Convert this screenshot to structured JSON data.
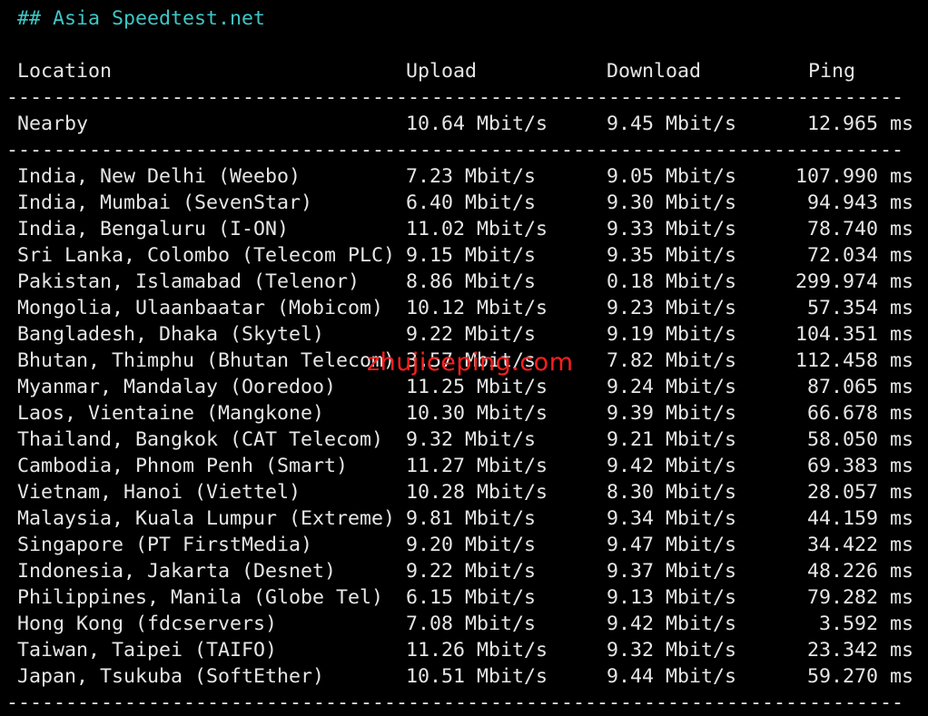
{
  "heading": "## Asia Speedtest.net",
  "columns": {
    "location": "Location",
    "upload": "Upload",
    "download": "Download",
    "ping": "Ping"
  },
  "divider": "----------------------------------------------------------------------------",
  "nearby": {
    "location": "Nearby",
    "upload": "10.64 Mbit/s",
    "download": "9.45 Mbit/s",
    "ping": "12.965 ms"
  },
  "rows": [
    {
      "location": "India, New Delhi (Weebo)",
      "upload": "7.23 Mbit/s",
      "download": "9.05 Mbit/s",
      "ping": "107.990 ms"
    },
    {
      "location": "India, Mumbai (SevenStar)",
      "upload": "6.40 Mbit/s",
      "download": "9.30 Mbit/s",
      "ping": "94.943 ms"
    },
    {
      "location": "India, Bengaluru (I-ON)",
      "upload": "11.02 Mbit/s",
      "download": "9.33 Mbit/s",
      "ping": "78.740 ms"
    },
    {
      "location": "Sri Lanka, Colombo (Telecom PLC)",
      "upload": "9.15 Mbit/s",
      "download": "9.35 Mbit/s",
      "ping": "72.034 ms"
    },
    {
      "location": "Pakistan, Islamabad (Telenor)",
      "upload": "8.86 Mbit/s",
      "download": "0.18 Mbit/s",
      "ping": "299.974 ms"
    },
    {
      "location": "Mongolia, Ulaanbaatar (Mobicom)",
      "upload": "10.12 Mbit/s",
      "download": "9.23 Mbit/s",
      "ping": "57.354 ms"
    },
    {
      "location": "Bangladesh, Dhaka (Skytel)",
      "upload": "9.22 Mbit/s",
      "download": "9.19 Mbit/s",
      "ping": "104.351 ms"
    },
    {
      "location": "Bhutan, Thimphu (Bhutan Telecom)",
      "upload": "3.57 Mbit/s",
      "download": "7.82 Mbit/s",
      "ping": "112.458 ms"
    },
    {
      "location": "Myanmar, Mandalay (Ooredoo)",
      "upload": "11.25 Mbit/s",
      "download": "9.24 Mbit/s",
      "ping": "87.065 ms"
    },
    {
      "location": "Laos, Vientaine (Mangkone)",
      "upload": "10.30 Mbit/s",
      "download": "9.39 Mbit/s",
      "ping": "66.678 ms"
    },
    {
      "location": "Thailand, Bangkok (CAT Telecom)",
      "upload": "9.32 Mbit/s",
      "download": "9.21 Mbit/s",
      "ping": "58.050 ms"
    },
    {
      "location": "Cambodia, Phnom Penh (Smart)",
      "upload": "11.27 Mbit/s",
      "download": "9.42 Mbit/s",
      "ping": "69.383 ms"
    },
    {
      "location": "Vietnam, Hanoi (Viettel)",
      "upload": "10.28 Mbit/s",
      "download": "8.30 Mbit/s",
      "ping": "28.057 ms"
    },
    {
      "location": "Malaysia, Kuala Lumpur (Extreme)",
      "upload": "9.81 Mbit/s",
      "download": "9.34 Mbit/s",
      "ping": "44.159 ms"
    },
    {
      "location": "Singapore (PT FirstMedia)",
      "upload": "9.20 Mbit/s",
      "download": "9.47 Mbit/s",
      "ping": "34.422 ms"
    },
    {
      "location": "Indonesia, Jakarta (Desnet)",
      "upload": "9.22 Mbit/s",
      "download": "9.37 Mbit/s",
      "ping": "48.226 ms"
    },
    {
      "location": "Philippines, Manila (Globe Tel)",
      "upload": "6.15 Mbit/s",
      "download": "9.13 Mbit/s",
      "ping": "79.282 ms"
    },
    {
      "location": "Hong Kong (fdcservers)",
      "upload": "7.08 Mbit/s",
      "download": "9.42 Mbit/s",
      "ping": "3.592 ms"
    },
    {
      "location": "Taiwan, Taipei (TAIFO)",
      "upload": "11.26 Mbit/s",
      "download": "9.32 Mbit/s",
      "ping": "23.342 ms"
    },
    {
      "location": "Japan, Tsukuba (SoftEther)",
      "upload": "10.51 Mbit/s",
      "download": "9.44 Mbit/s",
      "ping": "59.270 ms"
    }
  ],
  "watermark": "zhujiceping.com",
  "colors": {
    "background": "#000000",
    "text": "#e6e6e6",
    "heading": "#3fc6c6",
    "watermark": "#ff1f1f"
  }
}
